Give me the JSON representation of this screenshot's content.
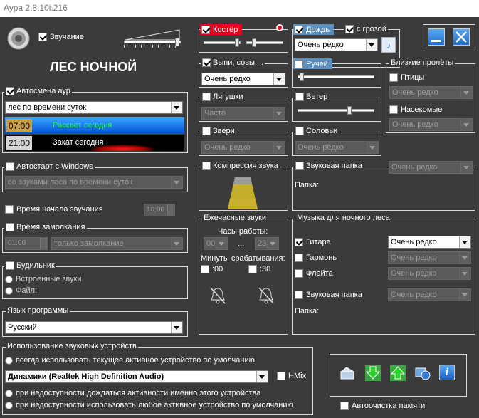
{
  "window": {
    "title": "Аура 2.8.10i.216"
  },
  "header": {
    "sound_label": "Звучание",
    "location_title": "ЛЕС НОЧНОЙ"
  },
  "aura_change": {
    "label": "Автосмена аур",
    "mode": "лес по времени суток",
    "sunrise_time": "07:00",
    "sunrise_label": "Рассвет сегодня",
    "sunset_time": "21:00",
    "sunset_label": "Закат сегодня"
  },
  "autostart": {
    "label": "Автостарт с Windows",
    "mode": "со звуками леса по времени суток"
  },
  "start_time": {
    "label": "Время начала звучания",
    "value": "10:00"
  },
  "lock_time": {
    "label": "Время замолкания",
    "value": "01:00",
    "mode": "только замолкание"
  },
  "alarm": {
    "label": "Будильник",
    "opt_builtin": "Встроенные звуки",
    "opt_file": "Файл:"
  },
  "language": {
    "label": "Язык программы",
    "value": "Русский"
  },
  "devices": {
    "label": "Использование звуковых устройств",
    "opt_always": "всегда использовать текущее активное устройство по умолчанию",
    "device": "Динамики (Realtek High Definition Audio)",
    "hmix": "HMix",
    "opt_wait": "при недоступности дождаться активности именно этого устройства",
    "opt_any": "при недоступности использовать любое активное устройство по умолчанию"
  },
  "sounds": {
    "campfire": {
      "label": "Костёр"
    },
    "rain": {
      "label": "Дождь",
      "thunder": "с грозой",
      "freq": "Очень редко"
    },
    "owls": {
      "label": "Выпи, совы ...",
      "freq": "Очень редко"
    },
    "stream": {
      "label": "Ручей"
    },
    "frogs": {
      "label": "Лягушки",
      "freq": "Часто"
    },
    "wind": {
      "label": "Ветер"
    },
    "beasts": {
      "label": "Звери",
      "freq": "Очень редко"
    },
    "nightingales": {
      "label": "Соловьи",
      "freq": "Очень редко"
    },
    "flyby": {
      "label": "Близкие пролёты",
      "birds": "Птицы",
      "birds_freq": "Очень редко",
      "insects": "Насекомые",
      "insects_freq": "Очень редко"
    },
    "compression": {
      "label": "Компрессия звука"
    },
    "sound_folder": {
      "label": "Звуковая папка",
      "freq": "Очень редко",
      "folder_label": "Папка:"
    }
  },
  "hourly": {
    "label": "Ежечасные звуки",
    "work_hours": "Часы работы:",
    "from": "00",
    "dots": "...",
    "to": "23",
    "minutes_label": "Минуты срабатывания:",
    "min00": ":00",
    "min30": ":30"
  },
  "music": {
    "label": "Музыка для ночного леса",
    "guitar": "Гитара",
    "guitar_freq": "Очень редко",
    "accordion": "Гармонь",
    "accordion_freq": "Очень редко",
    "flute": "Флейта",
    "flute_freq": "Очень редко",
    "folder": "Звуковая папка",
    "folder_freq": "Очень редко",
    "folder_label": "Папка:"
  },
  "bottom": {
    "autoclean_label": "Автоочистка памяти"
  },
  "colors": {
    "background": "#3b3b3b",
    "accent_red": "#e8001c",
    "accent_blue": "#1f7ad6",
    "compression_yellow": "#c4ae2a"
  }
}
